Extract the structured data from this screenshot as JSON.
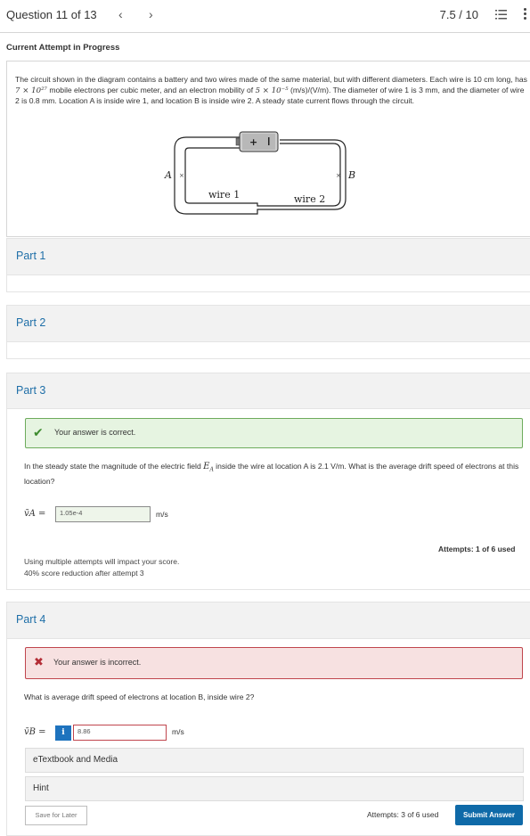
{
  "header": {
    "question_label": "Question 11 of 13",
    "prev_icon": "chevron-left-icon",
    "next_icon": "chevron-right-icon",
    "score": "7.5 / 10",
    "list_icon": "list-icon",
    "more_icon": "more-vertical-icon"
  },
  "attempt_title": "Current Attempt in Progress",
  "problem": {
    "text_1": "The circuit shown in the diagram contains a battery and two wires made of the same material, but with different diameters. Each wire is 10 cm long, has ",
    "density_math": "7 × 10²⁷",
    "text_2": " mobile electrons per cubic meter, and an electron mobility of ",
    "mobility_math": "5 × 10⁻⁵",
    "text_3": " (m/s)/(V/m). The diameter of wire 1 is 3 mm, and the diameter of wire 2 is 0.8 mm. Location A is inside wire 1, and location B is inside wire 2. A steady state current flows through the circuit.",
    "diagram": {
      "label_a": "A",
      "label_b": "B",
      "label_wire1": "wire 1",
      "label_wire2": "wire 2"
    }
  },
  "parts": {
    "part1": {
      "title": "Part 1"
    },
    "part2": {
      "title": "Part 2"
    },
    "part3": {
      "title": "Part 3",
      "feedback": "Your answer is correct.",
      "question_1": "In the steady state the magnitude of the electric field ",
      "field_symbol": "E",
      "field_sub": "A",
      "question_2": " inside the wire at location A is 2.1 V/m. What is the average drift speed of electrons at this location?",
      "answer_label": "v̄A =",
      "answer_value": "1.05e-4",
      "unit": "m/s",
      "attempts": "Attempts: 1 of 6 used",
      "note_line1": "Using multiple attempts will impact your score.",
      "note_line2": "40% score reduction after attempt 3"
    },
    "part4": {
      "title": "Part 4",
      "feedback": "Your answer is incorrect.",
      "question": "What is average drift speed of electrons at location B, inside wire 2?",
      "answer_label": "v̄B =",
      "info_badge": "i",
      "answer_value": "8.86",
      "unit": "m/s",
      "etextbook": "eTextbook and Media",
      "hint": "Hint",
      "save_label": "Save for Later",
      "attempts": "Attempts: 3 of 6 used",
      "submit_label": "Submit Answer"
    }
  },
  "colors": {
    "accent": "#0f6aa8",
    "correct_bg": "#e6f4e1",
    "incorrect_bg": "#f7e1e1",
    "part_title": "#1f6fa8"
  }
}
